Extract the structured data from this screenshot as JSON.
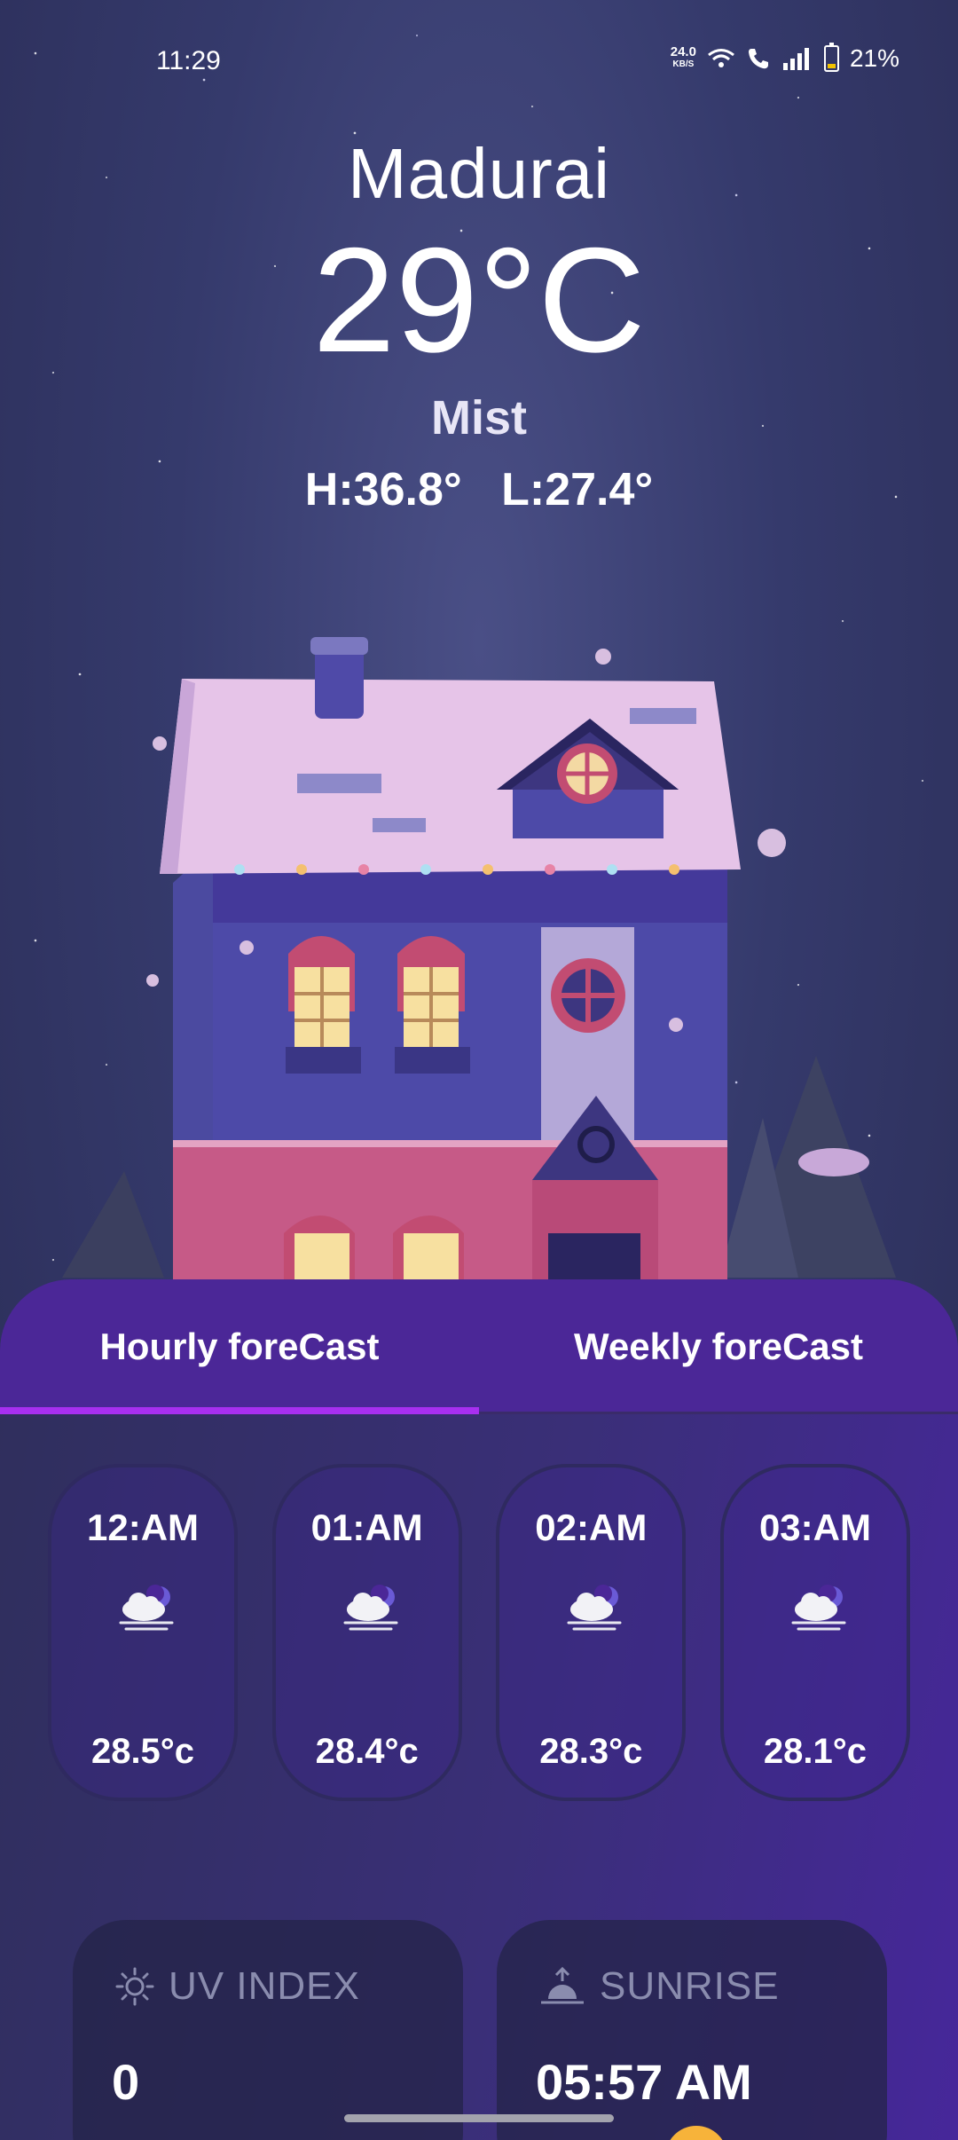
{
  "status_bar": {
    "time": "11:29",
    "net_speed_value": "24.0",
    "net_speed_unit": "KB/S",
    "battery": "21%"
  },
  "weather": {
    "city": "Madurai",
    "temperature": "29°C",
    "condition": "Mist",
    "hi_lo": "H:36.8°   L:27.4°"
  },
  "tabs": [
    {
      "label": "Hourly foreCast",
      "active": true
    },
    {
      "label": "Weekly foreCast",
      "active": false
    }
  ],
  "hourly": [
    {
      "time": "12:AM",
      "temp": "28.5°c",
      "icon": "night-cloud-mist-icon"
    },
    {
      "time": "01:AM",
      "temp": "28.4°c",
      "icon": "night-cloud-mist-icon"
    },
    {
      "time": "02:AM",
      "temp": "28.3°c",
      "icon": "night-cloud-mist-icon"
    },
    {
      "time": "03:AM",
      "temp": "28.1°c",
      "icon": "night-cloud-mist-icon"
    }
  ],
  "uv": {
    "label": "UV INDEX",
    "value": "0",
    "icon": "sun-icon"
  },
  "sunrise": {
    "label": "SUNRISE",
    "value": "05:57 AM",
    "icon": "sunrise-icon"
  },
  "colors": {
    "tab_bar": "#4b2797",
    "tab_indicator": "#a82ff0",
    "sun": "#f7b33a"
  }
}
